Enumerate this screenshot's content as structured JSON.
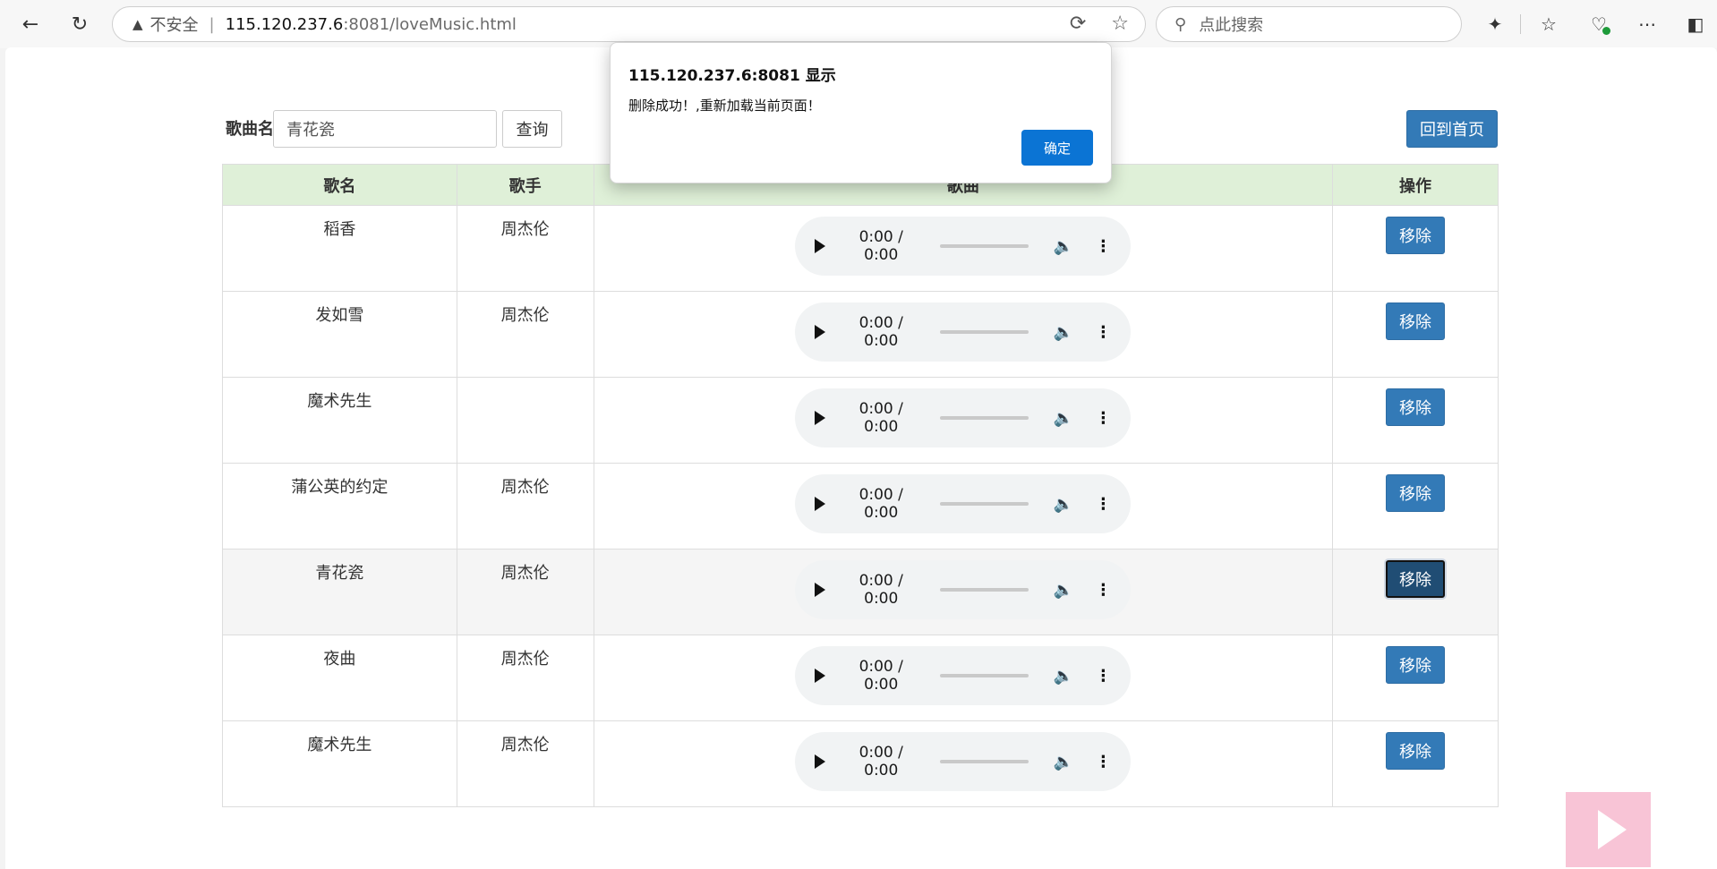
{
  "browser": {
    "insecure_label": "不安全",
    "url_host": "115.120.237.6",
    "url_path": ":8081/loveMusic.html",
    "search_placeholder": "点此搜索"
  },
  "toolbar": {
    "song_label": "歌曲名",
    "search_value": "青花瓷",
    "query_label": "查询",
    "home_label": "回到首页"
  },
  "table": {
    "headers": [
      "歌名",
      "歌手",
      "歌曲",
      "操作"
    ],
    "time_label": "0:00 / 0:00",
    "remove_label": "移除",
    "rows": [
      {
        "name": "稻香",
        "singer": "周杰伦"
      },
      {
        "name": "发如雪",
        "singer": "周杰伦"
      },
      {
        "name": "魔术先生",
        "singer": ""
      },
      {
        "name": "蒲公英的约定",
        "singer": "周杰伦"
      },
      {
        "name": "青花瓷",
        "singer": "周杰伦"
      },
      {
        "name": "夜曲",
        "singer": "周杰伦"
      },
      {
        "name": "魔术先生",
        "singer": "周杰伦"
      }
    ]
  },
  "dialog": {
    "title": "115.120.237.6:8081 显示",
    "message": "删除成功！,重新加载当前页面！",
    "ok_label": "确定"
  },
  "colors": {
    "primary": "#337ab7",
    "header_bg": "#dff0d8",
    "dialog_ok": "#0b74d4",
    "float_play": "#f8c4d6"
  }
}
